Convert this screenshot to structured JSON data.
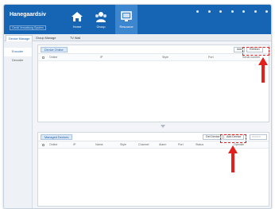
{
  "brand": {
    "name": "Hanegaardsiv",
    "sub": "Gerät Verwaltung System"
  },
  "nav": [
    {
      "label": "Home",
      "icon": "home-icon"
    },
    {
      "label": "Group",
      "icon": "group-icon"
    },
    {
      "label": "Resource",
      "icon": "resource-icon"
    }
  ],
  "tabs": [
    {
      "label": "Device Manage"
    },
    {
      "label": "Group Manage"
    },
    {
      "label": "TV Wall"
    }
  ],
  "sidebar": {
    "items": [
      {
        "label": "Encoder"
      },
      {
        "label": "Decoder"
      }
    ]
  },
  "online_panel": {
    "title": "Device Online",
    "columns": [
      "Online",
      "IP",
      "Style",
      "Port",
      "Serial number"
    ],
    "add_label": "Add",
    "refresh_label": "Refresh"
  },
  "managed_panel": {
    "title": "Managed Devices",
    "columns": [
      "Online",
      "IP",
      "Name",
      "Style",
      "Channel",
      "Alarm",
      "Port",
      "Status",
      "Operate"
    ],
    "del_label": "Del Device",
    "add_label": "Add Device",
    "search_placeholder": "search"
  },
  "colors": {
    "titlebar": "#1565b4",
    "accent": "#3b86cf",
    "highlight": "#e2211c"
  }
}
